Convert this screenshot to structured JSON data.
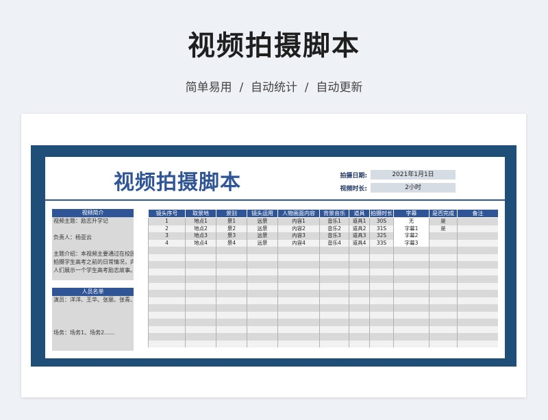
{
  "header": {
    "title": "视频拍摄脚本",
    "subtitle": "简单易用  /  自动统计  /  自动更新"
  },
  "sheet": {
    "title": "视频拍摄脚本",
    "shoot_date_label": "拍摄日期:",
    "shoot_date_value": "2021年1月1日",
    "duration_label": "视频时长:",
    "duration_value": "2小时"
  },
  "intro_panel": {
    "header": "视频简介",
    "lines": [
      "视频主题：励志升学记",
      "",
      "负责人：杨亚云",
      "",
      "主题介绍：本视频主要通过在校园",
      "拍摄学生高考之前的日常情况，向",
      "人们展示一个学生高考励志故事。"
    ]
  },
  "cast_panel": {
    "header": "人员名单",
    "lines": [
      "演员：洋洋、王华、张丽、张青、李",
      "",
      "",
      "",
      "场务：场务1、场务2......"
    ]
  },
  "table": {
    "columns": [
      "镜头序号",
      "取景地",
      "景别",
      "镜头运用",
      "人物画面内容",
      "背景音乐",
      "道具",
      "拍摄时长",
      "字幕",
      "是否完成",
      "备注"
    ],
    "rows": [
      [
        "1",
        "地点1",
        "景1",
        "远景",
        "内容1",
        "音乐1",
        "道具1",
        "30S",
        "无",
        "是",
        ""
      ],
      [
        "2",
        "地点2",
        "景2",
        "远景",
        "内容2",
        "音乐2",
        "道具2",
        "31S",
        "字幕1",
        "是",
        ""
      ],
      [
        "3",
        "地点3",
        "景3",
        "远景",
        "内容3",
        "音乐3",
        "道具3",
        "32S",
        "字幕2",
        "",
        ""
      ],
      [
        "4",
        "地点4",
        "景4",
        "远景",
        "内容4",
        "音乐4",
        "道具4",
        "33S",
        "字幕3",
        "",
        ""
      ]
    ],
    "empty_rows": 14
  }
}
